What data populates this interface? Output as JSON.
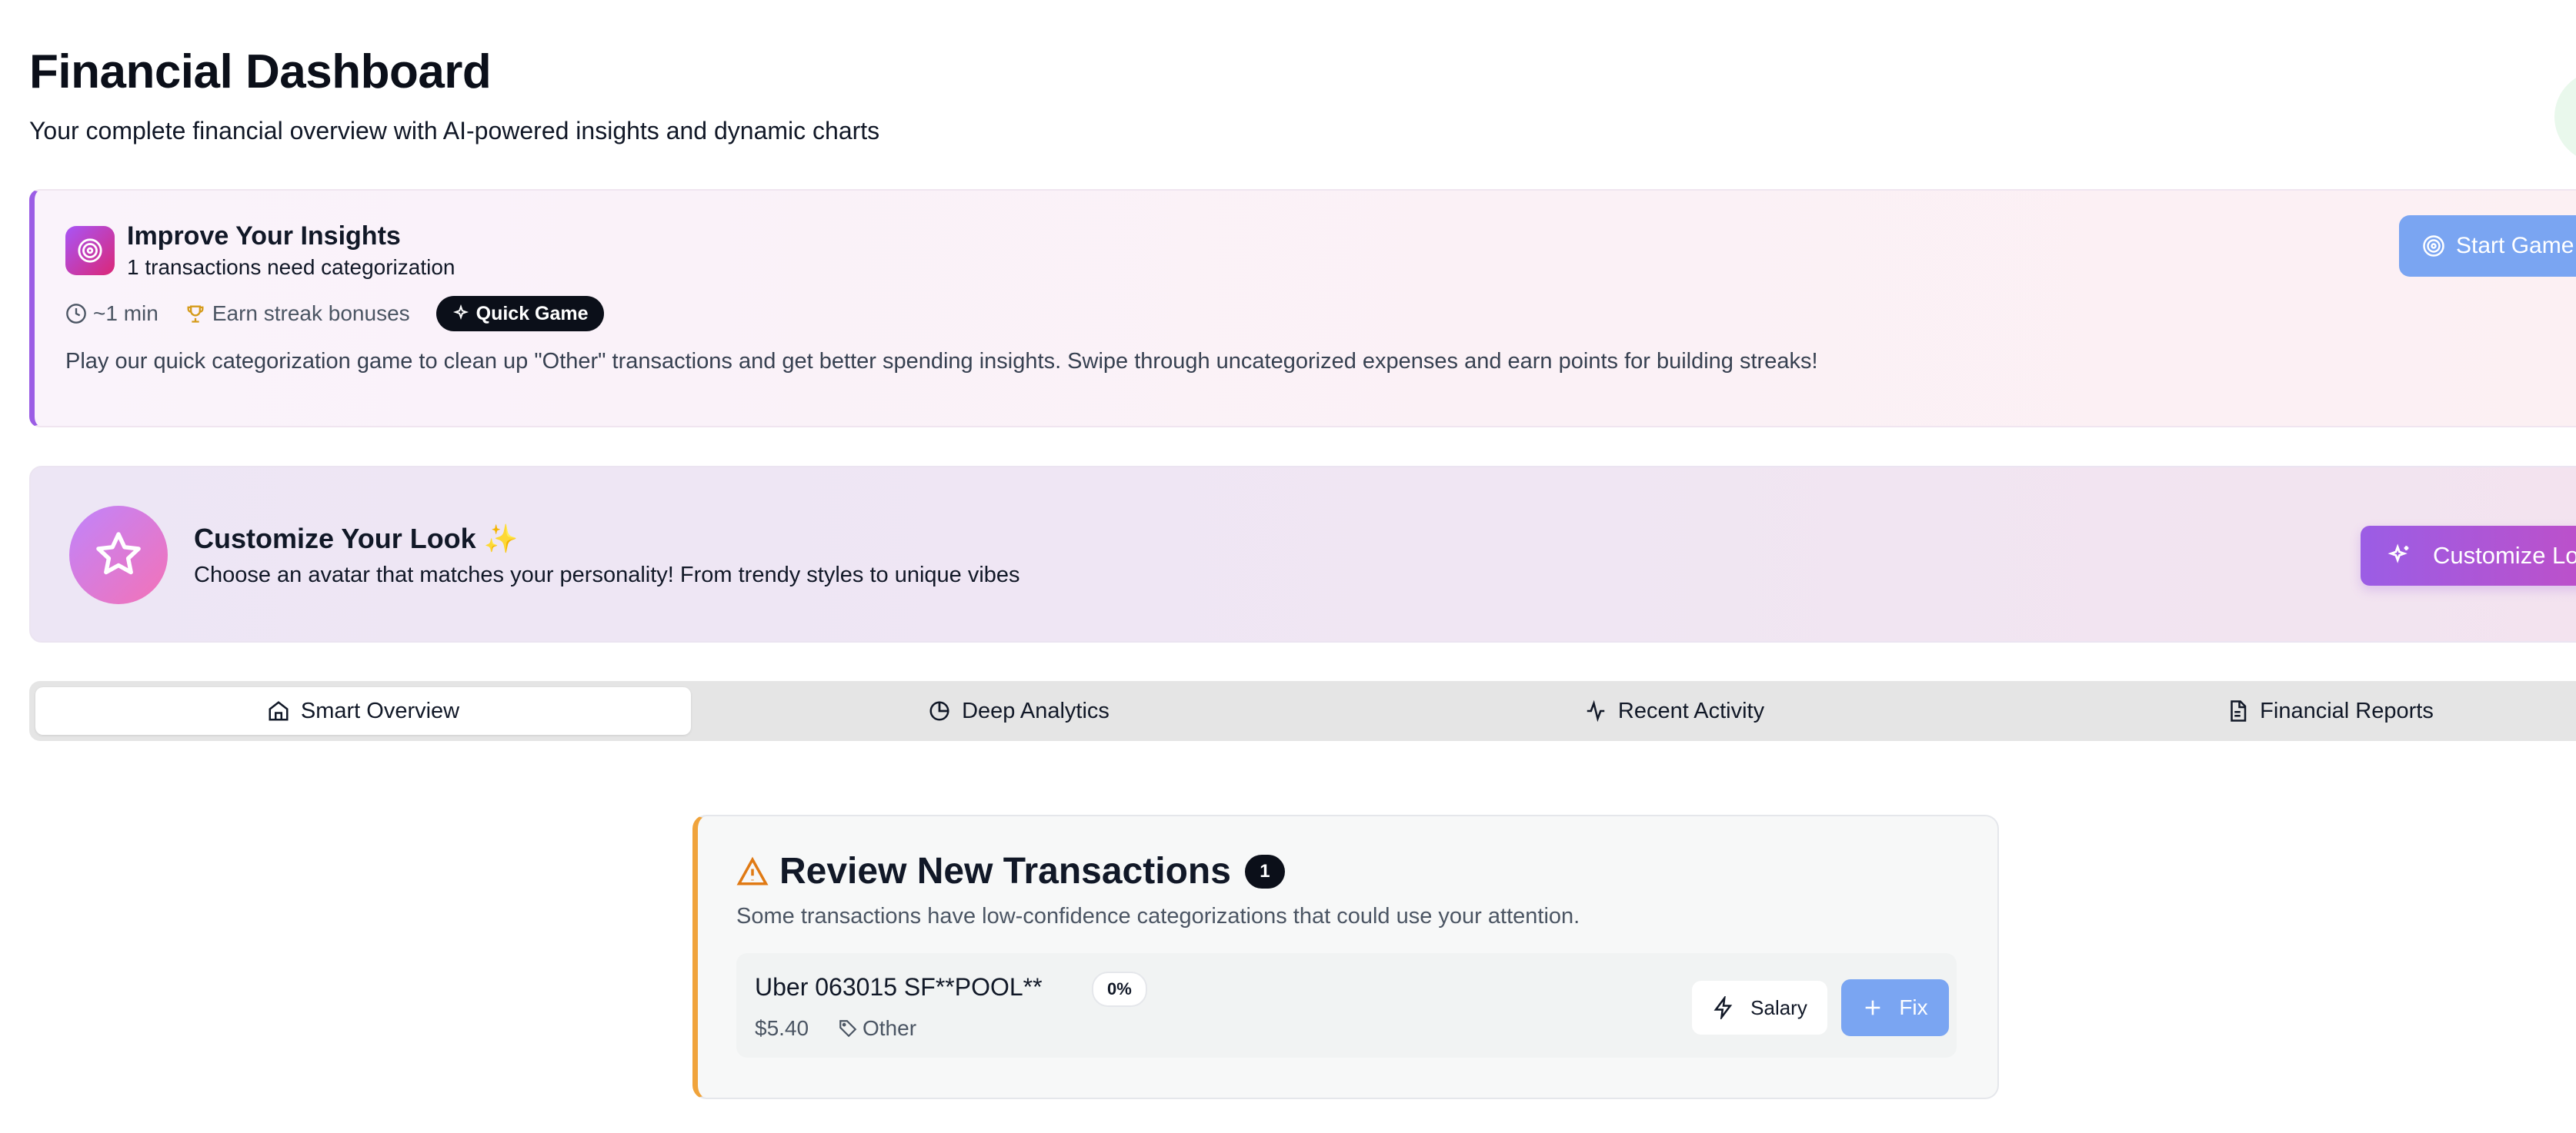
{
  "header": {
    "title": "Financial Dashboard",
    "subtitle": "Your complete financial overview with AI-powered insights and dynamic charts"
  },
  "insights": {
    "icon": "target-icon",
    "title": "Improve Your Insights",
    "subtitle": "1 transactions need categorization",
    "meta_time": "~1 min",
    "meta_streak": "Earn streak bonuses",
    "badge": "Quick Game",
    "description": "Play our quick categorization game to clean up \"Other\" transactions and get better spending insights. Swipe through uncategorized expenses and earn points for building streaks!",
    "start_button": "Start Game"
  },
  "customize": {
    "title": "Customize Your Look",
    "title_emoji": "✨",
    "description": "Choose an avatar that matches your personality! From trendy styles to unique vibes",
    "button": "Customize Look"
  },
  "tabs": [
    {
      "label": "Smart Overview",
      "icon": "home-icon",
      "active": true
    },
    {
      "label": "Deep Analytics",
      "icon": "pie-chart-icon",
      "active": false
    },
    {
      "label": "Recent Activity",
      "icon": "activity-icon",
      "active": false
    },
    {
      "label": "Financial Reports",
      "icon": "file-text-icon",
      "active": false
    }
  ],
  "review": {
    "title": "Review New Transactions",
    "count": "1",
    "description": "Some transactions have low-confidence categorizations that could use your attention.",
    "transaction": {
      "name": "Uber 063015 SF**POOL**",
      "confidence": "0%",
      "amount": "$5.40",
      "category": "Other",
      "suggestion": "Salary",
      "fix_label": "Fix"
    }
  },
  "colors": {
    "insights_accent": "#9b5de5",
    "review_accent": "#f0a33b",
    "primary_button": "#7aa5f2",
    "badge_dark": "#0b0f19"
  }
}
